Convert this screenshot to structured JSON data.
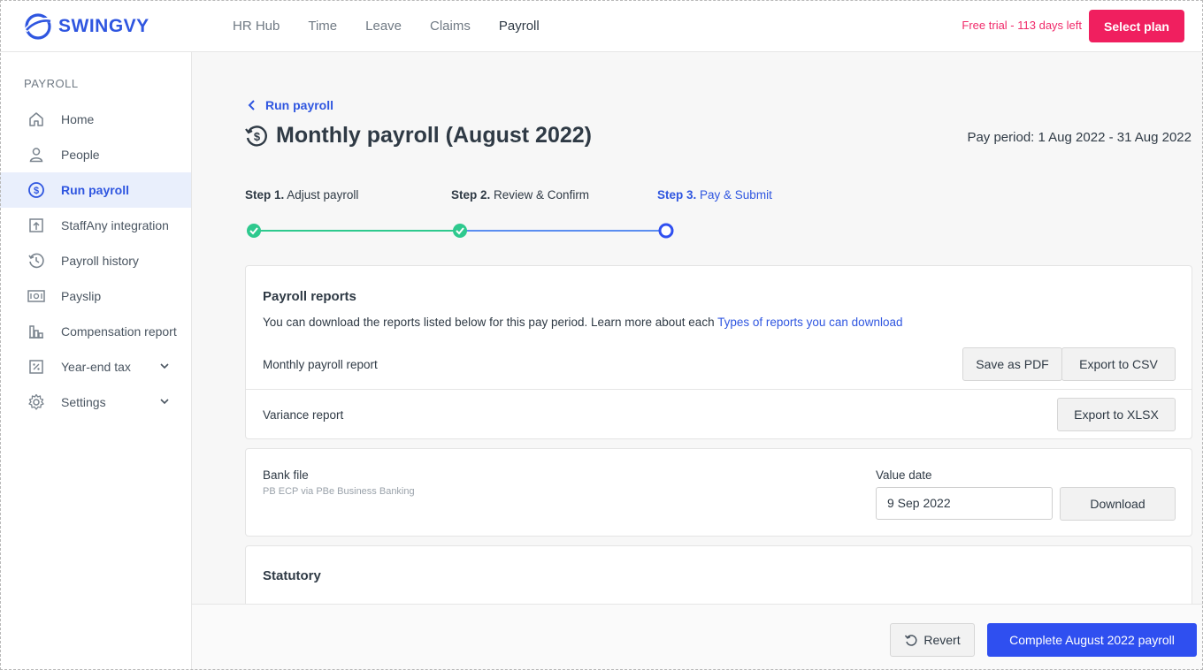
{
  "app": {
    "logo_text": "SWINGVY",
    "brand_color": "#2f56e0",
    "accent_color": "#f01f5f"
  },
  "nav": {
    "items": [
      "HR Hub",
      "Time",
      "Leave",
      "Claims",
      "Payroll"
    ],
    "active": "Payroll"
  },
  "trial": {
    "text": "Free trial - 113 days left",
    "button": "Select plan"
  },
  "sidebar": {
    "heading": "PAYROLL",
    "items": [
      {
        "label": "Home",
        "icon": "home-icon"
      },
      {
        "label": "People",
        "icon": "person-icon"
      },
      {
        "label": "Run payroll",
        "icon": "dollar-cycle-icon",
        "active": true
      },
      {
        "label": "StaffAny integration",
        "icon": "integration-icon"
      },
      {
        "label": "Payroll history",
        "icon": "history-icon"
      },
      {
        "label": "Payslip",
        "icon": "payslip-icon"
      },
      {
        "label": "Compensation report",
        "icon": "chart-icon"
      },
      {
        "label": "Year-end tax",
        "icon": "percent-icon",
        "expandable": true
      },
      {
        "label": "Settings",
        "icon": "gear-icon",
        "expandable": true
      }
    ]
  },
  "page": {
    "back_label": "Run payroll",
    "title": "Monthly payroll (August 2022)",
    "pay_period": "Pay period: 1 Aug 2022 - 31 Aug 2022"
  },
  "steps": [
    {
      "num": "Step 1.",
      "label": "Adjust payroll",
      "status": "done"
    },
    {
      "num": "Step 2.",
      "label": "Review & Confirm",
      "status": "done"
    },
    {
      "num": "Step 3.",
      "label": "Pay & Submit",
      "status": "current"
    }
  ],
  "reports": {
    "title": "Payroll reports",
    "desc": "You can download the reports listed below for this pay period. Learn more about each ",
    "desc_link": "Types of reports you can download",
    "monthly_label": "Monthly payroll report",
    "save_pdf": "Save as PDF",
    "export_csv": "Export to CSV",
    "variance_label": "Variance report",
    "export_xlsx": "Export to XLSX"
  },
  "bank": {
    "title": "Bank file",
    "sub": "PB ECP via PBe Business Banking",
    "value_date_label": "Value date",
    "value_date": "9 Sep 2022",
    "download": "Download"
  },
  "statutory": {
    "title": "Statutory"
  },
  "footer": {
    "revert": "Revert",
    "complete": "Complete August 2022 payroll"
  }
}
